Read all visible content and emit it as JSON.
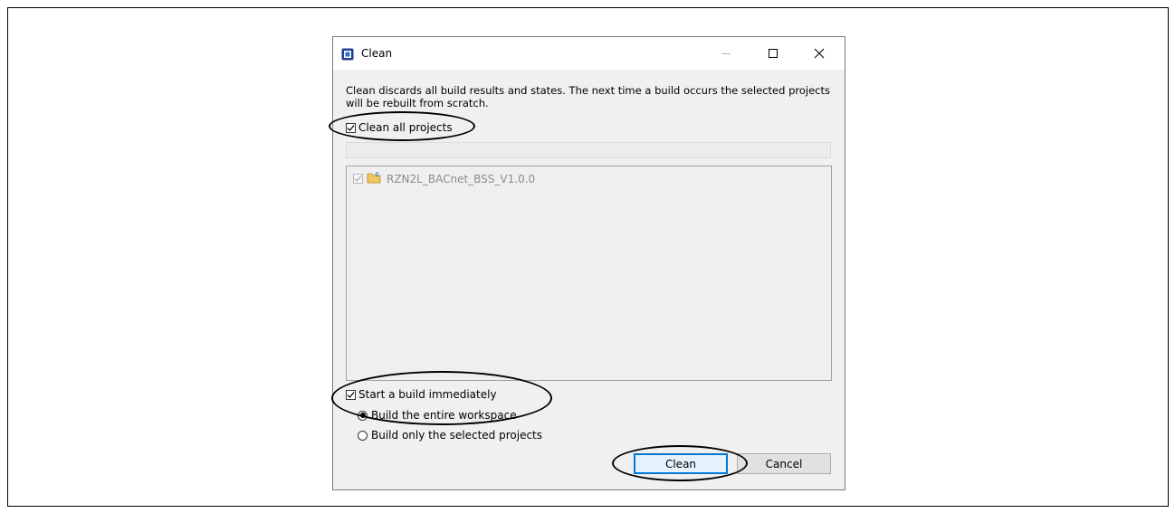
{
  "window": {
    "title": "Clean",
    "icon": "eclipse-app-icon",
    "controls": [
      "minimize",
      "maximize",
      "close"
    ]
  },
  "description": "Clean discards all build results and states. The next time a build occurs the selected projects will be rebuilt from scratch.",
  "clean_all": {
    "label": "Clean all projects",
    "checked": true
  },
  "filter": {
    "value": ""
  },
  "projects": [
    {
      "label": "RZN2L_BACnet_BSS_V1.0.0",
      "checked": true,
      "enabled": false,
      "icon": "c-project-folder-icon"
    }
  ],
  "build": {
    "start_label": "Start a build immediately",
    "start_checked": true,
    "options": [
      {
        "label": "Build the entire workspace",
        "selected": true
      },
      {
        "label": "Build only the selected projects",
        "selected": false
      }
    ]
  },
  "buttons": {
    "clean": "Clean",
    "cancel": "Cancel"
  },
  "colors": {
    "accent": "#0078d7",
    "dialog_bg": "#f0f0f0",
    "annotation": "#000000"
  }
}
